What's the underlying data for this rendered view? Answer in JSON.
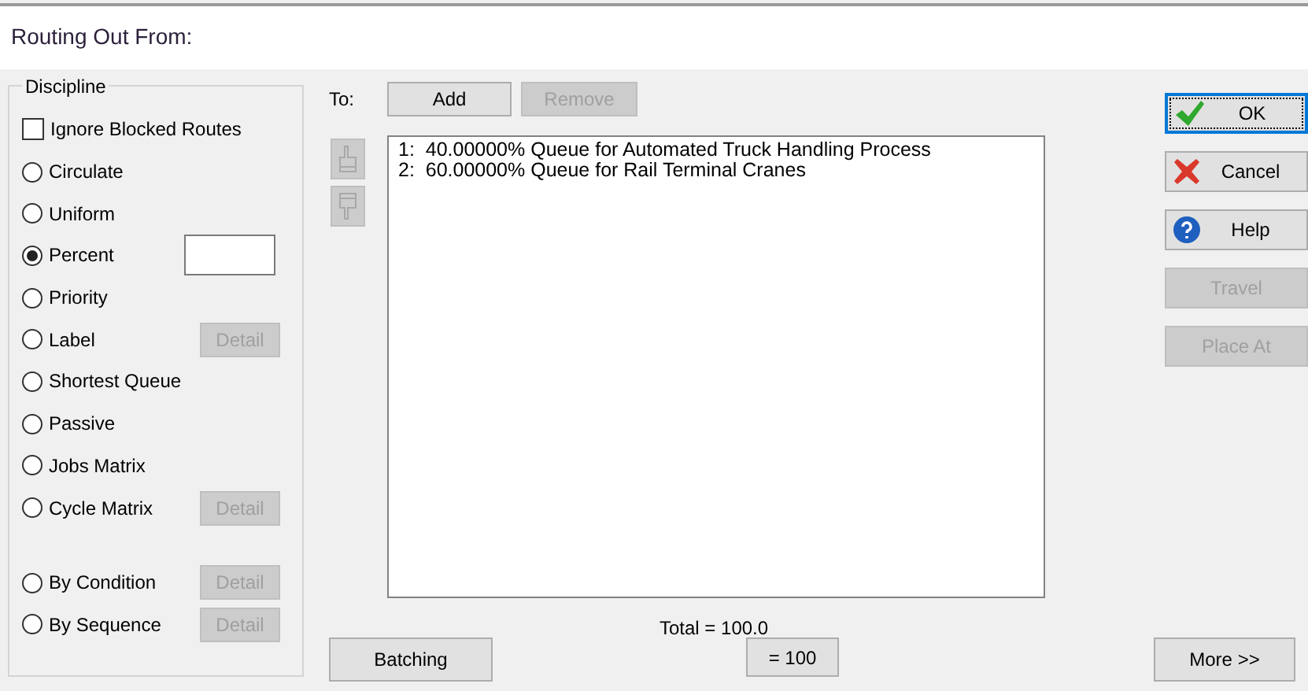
{
  "title": "Routing Out From:",
  "discipline": {
    "legend": "Discipline",
    "ignore_blocked": {
      "label": "Ignore Blocked Routes",
      "checked": false
    },
    "options": [
      {
        "label": "Circulate",
        "selected": false
      },
      {
        "label": "Uniform",
        "selected": false
      },
      {
        "label": "Percent",
        "selected": true,
        "has_field": true
      },
      {
        "label": "Priority",
        "selected": false
      },
      {
        "label": "Label",
        "selected": false,
        "detail": {
          "label": "Detail",
          "disabled": true
        }
      },
      {
        "label": "Shortest Queue",
        "selected": false
      },
      {
        "label": "Passive",
        "selected": false
      },
      {
        "label": "Jobs Matrix",
        "selected": false
      },
      {
        "label": "Cycle Matrix",
        "selected": false,
        "detail": {
          "label": "Detail",
          "disabled": true
        }
      },
      {
        "label": "By Condition",
        "selected": false,
        "spaced_before": true,
        "detail": {
          "label": "Detail",
          "disabled": true
        }
      },
      {
        "label": "By Sequence",
        "selected": false,
        "detail": {
          "label": "Detail",
          "disabled": true
        }
      }
    ]
  },
  "to_label": "To:",
  "add_button": {
    "label": "Add",
    "disabled": false
  },
  "remove_button": {
    "label": "Remove",
    "disabled": true
  },
  "move_buttons": [
    {
      "kind": "up",
      "disabled": true
    },
    {
      "kind": "down",
      "disabled": true
    }
  ],
  "routes": [
    {
      "text": "1:  40.00000% Queue for Automated Truck Handling Process"
    },
    {
      "text": "2:  60.00000% Queue for Rail Terminal Cranes"
    }
  ],
  "total": "Total = 100.0",
  "equal_button": {
    "label": "= 100",
    "disabled": false
  },
  "batching_button": {
    "label": "Batching",
    "disabled": false
  },
  "side_buttons": [
    {
      "label": "OK",
      "kind": "ok",
      "disabled": false,
      "focused": true
    },
    {
      "label": "Cancel",
      "kind": "cancel",
      "disabled": false,
      "focused": false
    },
    {
      "label": "Help",
      "kind": "help",
      "disabled": false,
      "focused": false
    },
    {
      "label": "Travel",
      "kind": "plain",
      "disabled": true,
      "focused": false
    },
    {
      "label": "Place At",
      "kind": "plain",
      "disabled": true,
      "focused": false
    }
  ],
  "more_button": {
    "label": "More >>",
    "disabled": false
  }
}
